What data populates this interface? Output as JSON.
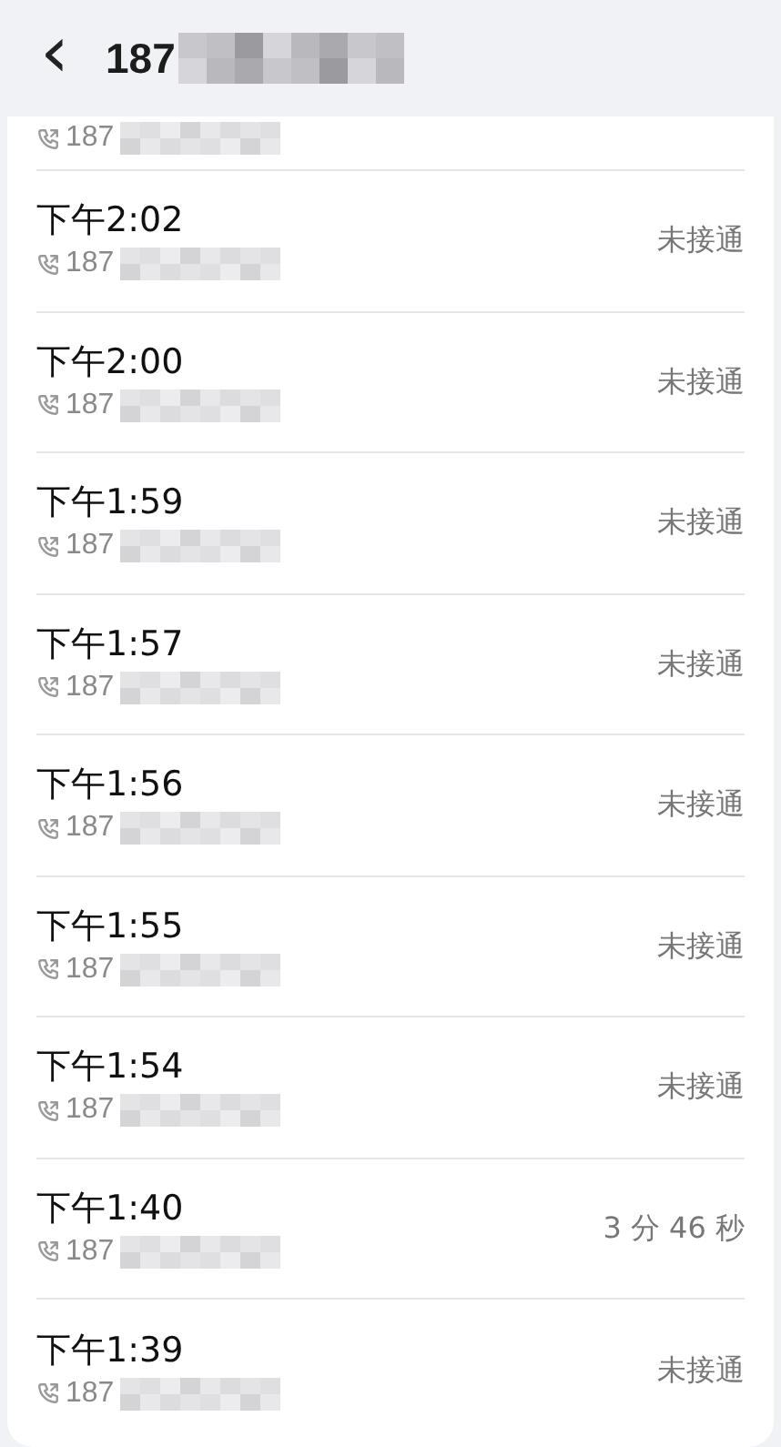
{
  "header": {
    "back": "‹",
    "title": "187"
  },
  "partial_row": {
    "number": "187"
  },
  "calls": [
    {
      "time": "下午2:02",
      "number": "187",
      "status": "未接通"
    },
    {
      "time": "下午2:00",
      "number": "187",
      "status": "未接通"
    },
    {
      "time": "下午1:59",
      "number": "187",
      "status": "未接通"
    },
    {
      "time": "下午1:57",
      "number": "187",
      "status": "未接通"
    },
    {
      "time": "下午1:56",
      "number": "187",
      "status": "未接通"
    },
    {
      "time": "下午1:55",
      "number": "187",
      "status": "未接通"
    },
    {
      "time": "下午1:54",
      "number": "187",
      "status": "未接通"
    },
    {
      "time": "下午1:40",
      "number": "187",
      "status": "3 分 46 秒"
    },
    {
      "time": "下午1:39",
      "number": "187",
      "status": "未接通"
    }
  ]
}
